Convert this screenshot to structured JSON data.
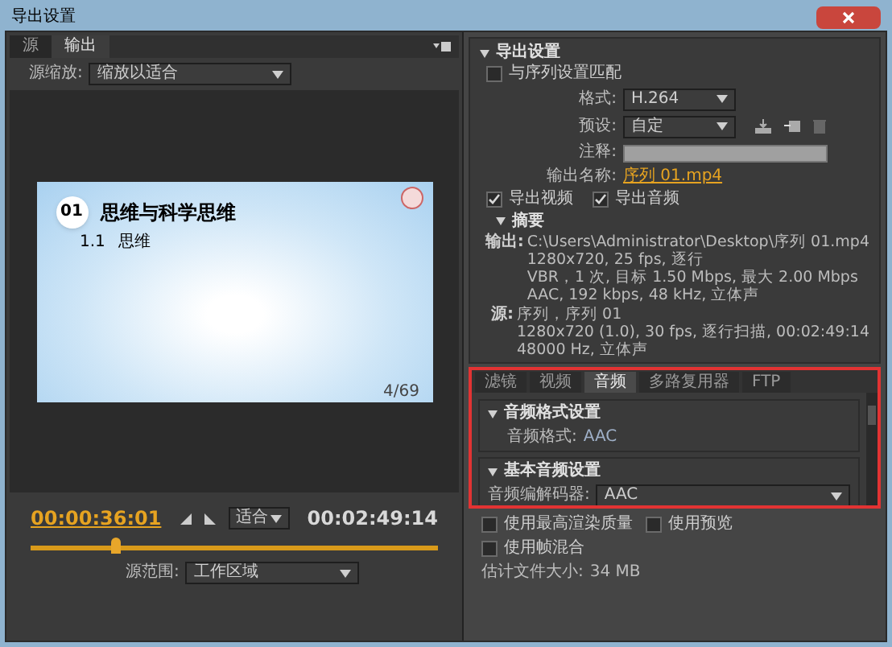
{
  "window": {
    "title": "导出设置"
  },
  "left": {
    "tabs": [
      {
        "label": "源",
        "selected": false
      },
      {
        "label": "输出",
        "selected": true
      }
    ],
    "source_zoom": {
      "label": "源缩放:",
      "value": "缩放以适合"
    },
    "slide": {
      "number": "01",
      "title": "思维与科学思维",
      "section_number": "1.1",
      "section_title": "思维",
      "page": "4/69"
    },
    "current_time": "00:00:36:01",
    "zoom": "适合",
    "duration": "00:02:49:14",
    "timeline": {
      "level": 0.21
    },
    "source_range": {
      "label": "源范围:",
      "value": "工作区域"
    }
  },
  "export_settings": {
    "heading": "导出设置",
    "match_sequence": {
      "label": "与序列设置匹配",
      "checked": false
    },
    "format": {
      "label": "格式:",
      "value": "H.264"
    },
    "preset": {
      "label": "预设:",
      "value": "自定"
    },
    "comment": {
      "label": "注释:"
    },
    "output_name": {
      "label": "输出名称:",
      "value": "序列 01.mp4"
    },
    "export_video": {
      "label": "导出视频",
      "checked": true
    },
    "export_audio": {
      "label": "导出音频",
      "checked": true
    },
    "summary": {
      "heading": "摘要",
      "output_label": "输出:",
      "output_lines": [
        "C:\\Users\\Administrator\\Desktop\\序列 01.mp4",
        "1280x720, 25 fps, 逐行",
        "VBR，1 次, 目标 1.50 Mbps, 最大 2.00 Mbps",
        "AAC, 192 kbps, 48 kHz, 立体声"
      ],
      "source_label": "源:",
      "source_lines": [
        "序列，序列 01",
        "1280x720 (1.0), 30 fps, 逐行扫描, 00:02:49:14",
        "48000 Hz, 立体声"
      ]
    }
  },
  "settings_tabs": [
    {
      "label": "滤镜",
      "selected": false
    },
    {
      "label": "视频",
      "selected": false
    },
    {
      "label": "音频",
      "selected": true
    },
    {
      "label": "多路复用器",
      "selected": false
    },
    {
      "label": "FTP",
      "selected": false
    }
  ],
  "audio": {
    "format_heading": "音频格式设置",
    "format_label": "音频格式:",
    "format_value": "AAC",
    "basic_heading": "基本音频设置",
    "codec_label": "音频编解码器:",
    "codec_value": "AAC"
  },
  "options": [
    {
      "label": "使用最高渲染质量",
      "checked": false
    },
    {
      "label": "使用预览",
      "checked": false
    },
    {
      "label": "使用帧混合",
      "checked": false
    }
  ],
  "estimate": {
    "label": "估计文件大小:",
    "value": "34 MB"
  }
}
